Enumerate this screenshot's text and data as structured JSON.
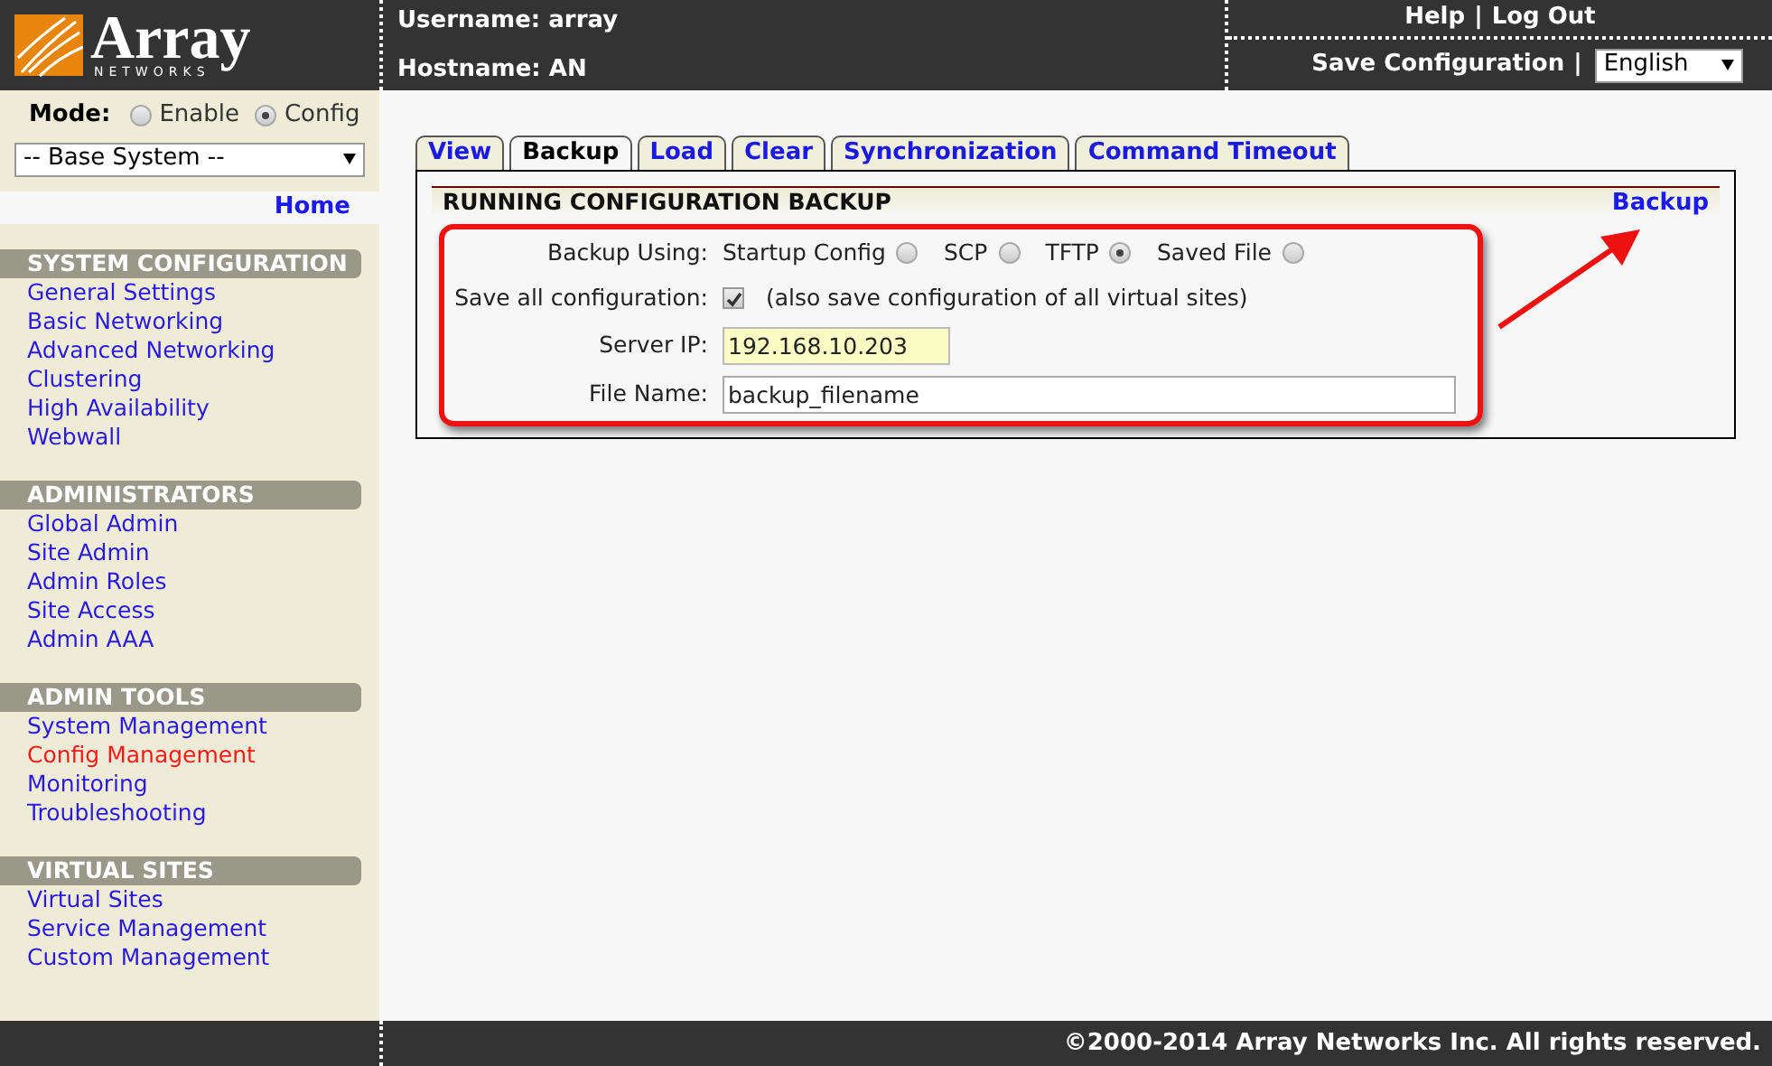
{
  "header": {
    "logo": {
      "name": "Array",
      "tagline": "NETWORKS"
    },
    "username": "Username: array",
    "hostname": "Hostname: AN",
    "top_links": [
      {
        "label": "Help"
      },
      {
        "label": "Log Out"
      }
    ],
    "separator": "|",
    "save_link": "Save Configuration",
    "save_separator": "|",
    "language": "English"
  },
  "sidebar": {
    "mode_label": "Mode:",
    "modes": [
      {
        "label": "Enable",
        "selected": false
      },
      {
        "label": "Config",
        "selected": true
      }
    ],
    "context": "-- Base System --",
    "home": "Home",
    "sections": [
      {
        "title": "SYSTEM CONFIGURATION",
        "items": [
          {
            "label": "General Settings",
            "selected": false
          },
          {
            "label": "Basic Networking",
            "selected": false
          },
          {
            "label": "Advanced Networking",
            "selected": false
          },
          {
            "label": "Clustering",
            "selected": false
          },
          {
            "label": "High Availability",
            "selected": false
          },
          {
            "label": "Webwall",
            "selected": false
          }
        ]
      },
      {
        "title": "ADMINISTRATORS",
        "items": [
          {
            "label": "Global Admin",
            "selected": false
          },
          {
            "label": "Site Admin",
            "selected": false
          },
          {
            "label": "Admin Roles",
            "selected": false
          },
          {
            "label": "Site Access",
            "selected": false
          },
          {
            "label": "Admin AAA",
            "selected": false
          }
        ]
      },
      {
        "title": "ADMIN TOOLS",
        "items": [
          {
            "label": "System Management",
            "selected": false
          },
          {
            "label": "Config Management",
            "selected": true
          },
          {
            "label": "Monitoring",
            "selected": false
          },
          {
            "label": "Troubleshooting",
            "selected": false
          }
        ]
      },
      {
        "title": "VIRTUAL SITES",
        "items": [
          {
            "label": "Virtual Sites",
            "selected": false
          },
          {
            "label": "Service Management",
            "selected": false
          },
          {
            "label": "Custom Management",
            "selected": false
          }
        ]
      }
    ]
  },
  "tabs": [
    {
      "label": "View",
      "selected": false
    },
    {
      "label": "Backup",
      "selected": true
    },
    {
      "label": "Load",
      "selected": false
    },
    {
      "label": "Clear",
      "selected": false
    },
    {
      "label": "Synchronization",
      "selected": false
    },
    {
      "label": "Command Timeout",
      "selected": false
    }
  ],
  "panel": {
    "title": "RUNNING CONFIGURATION BACKUP",
    "action": "Backup",
    "backup_using": {
      "label": "Backup Using:",
      "options": [
        {
          "label": "Startup Config",
          "selected": false
        },
        {
          "label": "SCP",
          "selected": false
        },
        {
          "label": "TFTP",
          "selected": true
        },
        {
          "label": "Saved File",
          "selected": false
        }
      ]
    },
    "save_all": {
      "label": "Save all configuration:",
      "checked": true,
      "note": "(also save configuration of all virtual sites)"
    },
    "server_ip": {
      "label": "Server IP:",
      "value": "192.168.10.203"
    },
    "file_name": {
      "label": "File Name:",
      "value": "backup_filename"
    }
  },
  "footer": {
    "copyright": "©2000-2014 Array Networks Inc. All rights reserved."
  }
}
